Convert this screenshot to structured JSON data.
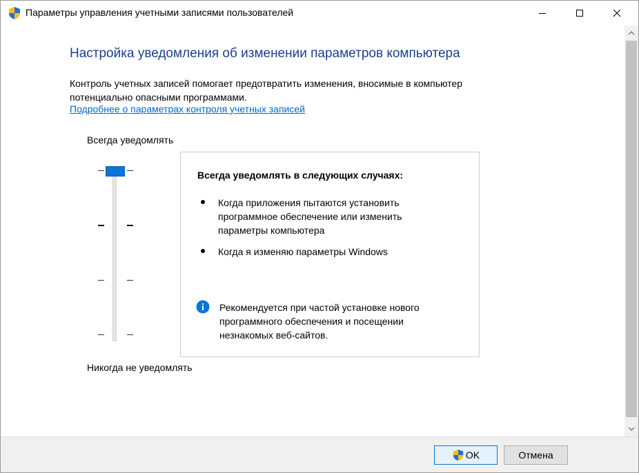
{
  "window": {
    "title": "Параметры управления учетными записями пользователей",
    "icon": "uac-shield-icon",
    "controls": [
      "minimize-icon",
      "maximize-icon",
      "close-icon"
    ]
  },
  "content": {
    "heading": "Настройка уведомления об изменении параметров компьютера",
    "description": "Контроль учетных записей помогает предотвратить изменения, вносимые в компьютер потенциально опасными программами.",
    "link": "Подробнее о параметрах контроля учетных записей"
  },
  "slider": {
    "label_top": "Всегда уведомлять",
    "label_bottom": "Никогда не уведомлять",
    "levels": 4,
    "selected_level": 4,
    "selected_level_name": "Всегда уведомлять",
    "accent_color": "#0a74da"
  },
  "panel": {
    "title": "Всегда уведомлять в следующих случаях:",
    "bullets": [
      "Когда приложения пытаются установить программное обеспечение или изменить параметры компьютера",
      "Когда я изменяю параметры Windows"
    ],
    "info_icon": "info-icon",
    "info_text": "Рекомендуется при частой установке нового программного обеспечения и посещении незнакомых веб-сайтов."
  },
  "buttons": {
    "ok": "OK",
    "cancel": "Отмена"
  },
  "colors": {
    "heading": "#1a3f91",
    "link": "#0066cc",
    "info": "#0a74da"
  }
}
